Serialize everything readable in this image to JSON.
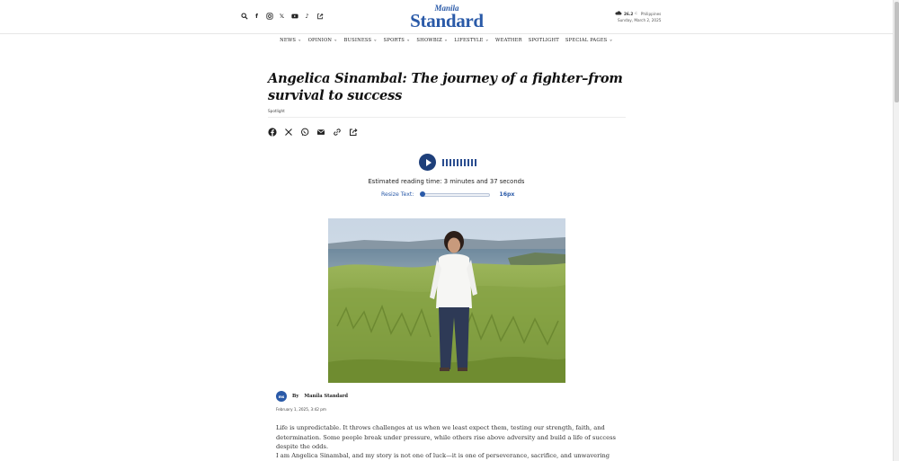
{
  "header": {
    "social_icons": [
      "search-icon",
      "facebook-icon",
      "instagram-icon",
      "x-icon",
      "youtube-icon",
      "tiktok-icon",
      "share-icon"
    ],
    "logo": {
      "line1": "Manila",
      "line2": "Standard"
    },
    "weather": {
      "temp": "26.2",
      "unit": "C",
      "location": "Philippines",
      "date": "Sunday, March 2, 2025"
    }
  },
  "nav": {
    "items": [
      {
        "label": "NEWS",
        "dropdown": true
      },
      {
        "label": "OPINION",
        "dropdown": true
      },
      {
        "label": "BUSINESS",
        "dropdown": true
      },
      {
        "label": "SPORTS",
        "dropdown": true
      },
      {
        "label": "SHOWBIZ",
        "dropdown": true
      },
      {
        "label": "LIFESTYLE",
        "dropdown": true
      },
      {
        "label": "WEATHER",
        "dropdown": false
      },
      {
        "label": "SPOTLIGHT",
        "dropdown": false
      },
      {
        "label": "SPECIAL PAGES",
        "dropdown": true
      }
    ]
  },
  "article": {
    "title": "Angelica Sinambal: The journey of a fighter–from survival to success",
    "category": "Spotlight",
    "share_icons": [
      "facebook-icon",
      "x-icon",
      "whatsapp-icon",
      "email-icon",
      "link-icon",
      "share-icon"
    ],
    "reading_time": "Estimated reading time: 3 minutes and 37 seconds",
    "resize": {
      "label": "Resize Text:",
      "value": "16px"
    },
    "byline": {
      "avatar_text": "ms",
      "by": "By",
      "author": "Manila Standard"
    },
    "date": "February 1, 2025, 3:42 pm",
    "paragraphs": [
      "Life is unpredictable. It throws challenges at us when we least expect them, testing our strength, faith, and determination. Some people break under pressure, while others rise above adversity and build a life of success despite the odds.",
      "I am Angelica Sinambal, and my story is not one of luck—it is one of perseverance, sacrifice, and unwavering resilience."
    ]
  },
  "colors": {
    "brand": "#2a5aa8",
    "play_button": "#1e3f7a"
  }
}
